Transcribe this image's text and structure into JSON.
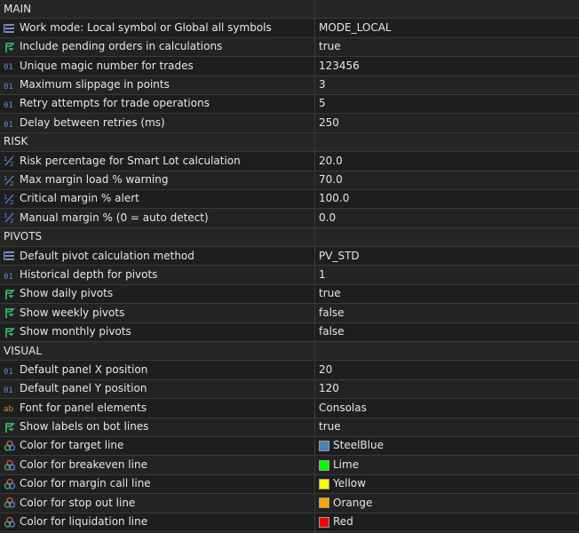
{
  "rows": [
    {
      "type": "section",
      "label": "MAIN"
    },
    {
      "icon": "enum-icon",
      "name": "Work mode: Local symbol or Global all symbols",
      "value": "MODE_LOCAL"
    },
    {
      "icon": "bool-icon",
      "name": "Include pending orders in calculations",
      "value": "true"
    },
    {
      "icon": "int-icon",
      "name": "Unique magic number for trades",
      "value": "123456"
    },
    {
      "icon": "int-icon",
      "name": "Maximum slippage in points",
      "value": "3"
    },
    {
      "icon": "int-icon",
      "name": "Retry attempts for trade operations",
      "value": "5"
    },
    {
      "icon": "int-icon",
      "name": "Delay between retries (ms)",
      "value": "250"
    },
    {
      "type": "section",
      "label": "RISK"
    },
    {
      "icon": "double-icon",
      "name": "Risk percentage for Smart Lot calculation",
      "value": "20.0"
    },
    {
      "icon": "double-icon",
      "name": "Max margin load % warning",
      "value": "70.0"
    },
    {
      "icon": "double-icon",
      "name": "Critical margin % alert",
      "value": "100.0"
    },
    {
      "icon": "double-icon",
      "name": "Manual margin % (0 = auto detect)",
      "value": "0.0"
    },
    {
      "type": "section",
      "label": "PIVOTS"
    },
    {
      "icon": "enum-icon",
      "name": "Default pivot calculation method",
      "value": "PV_STD"
    },
    {
      "icon": "int-icon",
      "name": "Historical depth for pivots",
      "value": "1"
    },
    {
      "icon": "bool-icon",
      "name": "Show daily pivots",
      "value": "true"
    },
    {
      "icon": "bool-icon",
      "name": "Show weekly pivots",
      "value": "false"
    },
    {
      "icon": "bool-icon",
      "name": "Show monthly pivots",
      "value": "false"
    },
    {
      "type": "section",
      "label": "VISUAL"
    },
    {
      "icon": "int-icon",
      "name": "Default panel X position",
      "value": "20"
    },
    {
      "icon": "int-icon",
      "name": "Default panel Y position",
      "value": "120"
    },
    {
      "icon": "string-icon",
      "name": "Font for panel elements",
      "value": "Consolas"
    },
    {
      "icon": "bool-icon",
      "name": "Show labels on bot lines",
      "value": "true"
    },
    {
      "icon": "color-icon",
      "name": "Color for target line",
      "value": "SteelBlue",
      "color": "#4682b4"
    },
    {
      "icon": "color-icon",
      "name": "Color for breakeven line",
      "value": "Lime",
      "color": "#00ff00"
    },
    {
      "icon": "color-icon",
      "name": "Color for margin call line",
      "value": "Yellow",
      "color": "#ffff00"
    },
    {
      "icon": "color-icon",
      "name": "Color for stop out line",
      "value": "Orange",
      "color": "#ffa500"
    },
    {
      "icon": "color-icon",
      "name": "Color for liquidation line",
      "value": "Red",
      "color": "#ff0000"
    }
  ],
  "icon_colors": {
    "enum": "#7a8fbf",
    "bool": "#3ac26b",
    "int": "#5b8fd6",
    "double": "#5b8fd6",
    "string": "#d98a3a"
  }
}
